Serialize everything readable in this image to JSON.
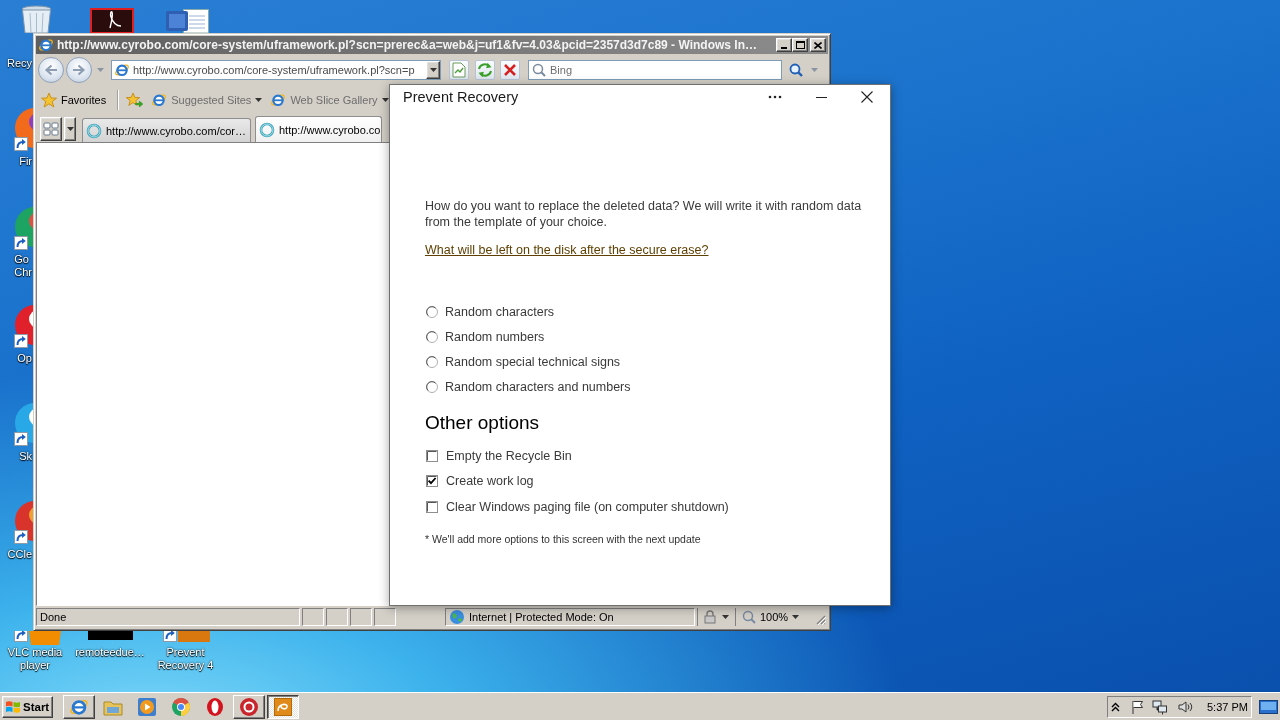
{
  "desktop": {
    "icons": [
      {
        "kind": "recycle-bin",
        "label": "Recy",
        "shortcut": false
      },
      {
        "kind": "pdf",
        "shortcut": false
      },
      {
        "kind": "word",
        "shortcut": false
      },
      {
        "kind": "firefox",
        "label": "Fir",
        "shortcut": true
      },
      {
        "kind": "chrome",
        "label": "Go Chr",
        "shortcut": true
      },
      {
        "kind": "opera",
        "label": "Op",
        "shortcut": true
      },
      {
        "kind": "skype",
        "label": "Sk",
        "shortcut": true
      },
      {
        "kind": "ccleaner",
        "label": "CCle",
        "shortcut": true
      },
      {
        "kind": "vlc",
        "label": "VLC media player",
        "shortcut": true
      },
      {
        "kind": "app",
        "label": "remoteedue…",
        "shortcut": false
      },
      {
        "kind": "prevent-recovery",
        "label": "Prevent Recovery 4",
        "shortcut": true
      }
    ]
  },
  "browser": {
    "title": "http://www.cyrobo.com/core-system/uframework.pl?scn=prerec&a=web&j=uf1&fv=4.03&pcid=2357d3d7c89 - Windows In…",
    "active": false,
    "address": "http://www.cyrobo.com/core-system/uframework.pl?scn=p",
    "search": {
      "placeholder": "Bing"
    },
    "favorites": {
      "label": "Favorites",
      "links": [
        {
          "label": "Suggested Sites"
        },
        {
          "label": "Web Slice Gallery"
        }
      ]
    },
    "tabs": [
      {
        "label": "http://www.cyrobo.com/cor…",
        "selected": false
      },
      {
        "label": "http://www.cyrobo.co",
        "selected": true
      }
    ],
    "status_bar": {
      "status": "Done",
      "zone": "Internet | Protected Mode: On",
      "zoom": "100%"
    }
  },
  "dialog": {
    "title": "Prevent Recovery",
    "intro": "How do you want to replace the deleted data? We will write it with random data from the template of your choice.",
    "link": "What will be left on the disk after the secure erase?",
    "fill_options": [
      {
        "label": "Random characters",
        "selected": false
      },
      {
        "label": "Random numbers",
        "selected": false
      },
      {
        "label": "Random special technical signs",
        "selected": false
      },
      {
        "label": "Random characters and numbers",
        "selected": false
      }
    ],
    "other_options": {
      "heading": "Other options",
      "items": [
        {
          "label": "Empty the Recycle Bin",
          "checked": false
        },
        {
          "label": "Create work log",
          "checked": true
        },
        {
          "label": "Clear Windows paging file (on computer shutdown)",
          "checked": false
        }
      ]
    },
    "footnote": "* We'll add more options to this screen with the next update"
  },
  "taskbar": {
    "start": "Start",
    "items": [
      {
        "kind": "ie",
        "running": true,
        "selected": false
      },
      {
        "kind": "folder",
        "running": false,
        "selected": false
      },
      {
        "kind": "media",
        "running": false,
        "selected": false
      },
      {
        "kind": "chrome",
        "running": false,
        "selected": false
      },
      {
        "kind": "opera",
        "running": false,
        "selected": false
      },
      {
        "kind": "p-app",
        "running": true,
        "selected": false
      },
      {
        "kind": "prevent-recovery",
        "running": true,
        "selected": true
      }
    ],
    "clock": "5:37 PM"
  }
}
